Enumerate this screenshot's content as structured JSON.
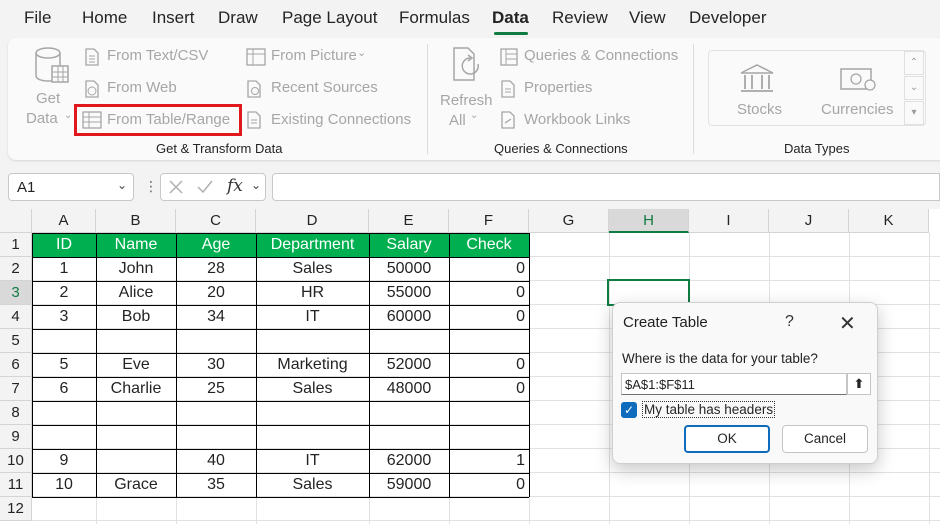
{
  "menu": [
    "File",
    "Home",
    "Insert",
    "Draw",
    "Page Layout",
    "Formulas",
    "Data",
    "Review",
    "View",
    "Developer"
  ],
  "menu_active": "Data",
  "ribbon": {
    "get_data": [
      "Get",
      "Data"
    ],
    "from_text_csv": "From Text/CSV",
    "from_web": "From Web",
    "from_table_range": "From Table/Range",
    "from_picture": "From Picture",
    "recent_sources": "Recent Sources",
    "existing_connections": "Existing Connections",
    "group_get_transform": "Get & Transform Data",
    "refresh_all": [
      "Refresh",
      "All"
    ],
    "queries_connections": "Queries & Connections",
    "properties": "Properties",
    "workbook_links": "Workbook Links",
    "group_queries": "Queries & Connections",
    "stocks": "Stocks",
    "currencies": "Currencies",
    "group_data_types": "Data Types"
  },
  "formula_bar": {
    "name_box": "A1",
    "fx": "fx",
    "formula": ""
  },
  "columns": [
    "A",
    "B",
    "C",
    "D",
    "E",
    "F",
    "G",
    "H",
    "I",
    "J",
    "K"
  ],
  "rows": [
    "1",
    "2",
    "3",
    "4",
    "5",
    "6",
    "7",
    "8",
    "9",
    "10",
    "11",
    "12"
  ],
  "table": {
    "headers": [
      "ID",
      "Name",
      "Age",
      "Department",
      "Salary",
      "Check"
    ],
    "rows": [
      [
        "1",
        "John",
        "28",
        "Sales",
        "50000",
        "0"
      ],
      [
        "2",
        "Alice",
        "20",
        "HR",
        "55000",
        "0"
      ],
      [
        "3",
        "Bob",
        "34",
        "IT",
        "60000",
        "0"
      ],
      [
        "",
        "",
        "",
        "",
        "",
        ""
      ],
      [
        "5",
        "Eve",
        "30",
        "Marketing",
        "52000",
        "0"
      ],
      [
        "6",
        "Charlie",
        "25",
        "Sales",
        "48000",
        "0"
      ],
      [
        "",
        "",
        "",
        "",
        "",
        ""
      ],
      [
        "",
        "",
        "",
        "",
        "",
        ""
      ],
      [
        "9",
        "",
        "40",
        "IT",
        "62000",
        "1"
      ],
      [
        "10",
        "Grace",
        "35",
        "Sales",
        "59000",
        "0"
      ]
    ]
  },
  "dialog": {
    "title": "Create Table",
    "help": "?",
    "close": "✕",
    "question": "Where is the data for your table?",
    "range": "$A$1:$F$11",
    "collapse": "⬆",
    "checkbox_label": "My table has headers",
    "checkbox_checked": true,
    "ok": "OK",
    "cancel": "Cancel"
  },
  "colors": {
    "accent": "#107c41",
    "header_fill": "#00b050",
    "highlight": "#e0181e",
    "checkbox": "#0f6cbd"
  }
}
